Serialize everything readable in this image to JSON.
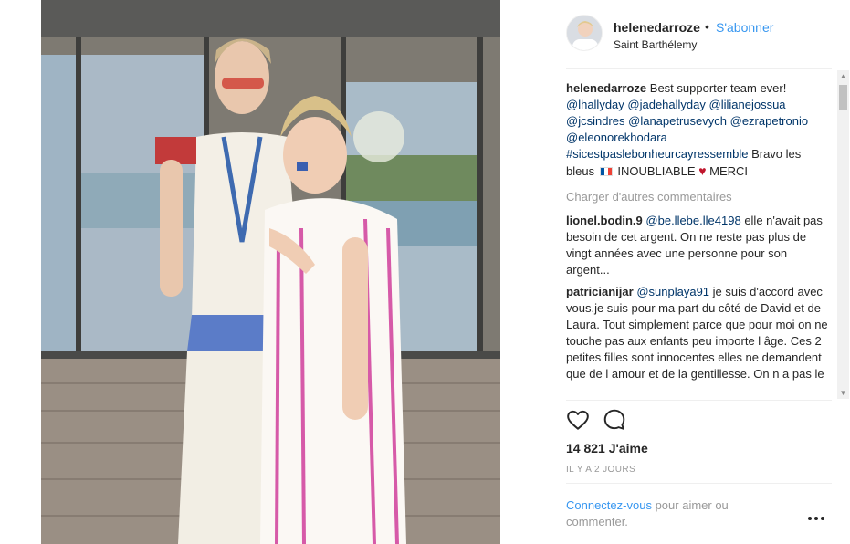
{
  "header": {
    "username": "helenedarroze",
    "dot": "•",
    "follow_label": "S'abonner",
    "location": "Saint Barthélemy"
  },
  "caption": {
    "username": "helenedarroze",
    "text_intro": "Best supporter team ever!",
    "mentions": [
      "@lhallyday",
      "@jadehallyday",
      "@lilianejossua",
      "@jcsindres",
      "@lanapetrusevych",
      "@ezrapetronio",
      "@eleonorekhodara",
      "#sicestpaslebonheurcayressemble"
    ],
    "text_bravo": "Bravo les bleus",
    "text_inoubliable": "INOUBLIABLE",
    "text_merci": "MERCI"
  },
  "load_more": "Charger d'autres commentaires",
  "comments": [
    {
      "username": "lionel.bodin.9",
      "mention": "@be.llebe.lle4198",
      "text": "elle n'avait pas besoin de cet argent. On ne reste pas plus de vingt années avec une personne pour son argent..."
    },
    {
      "username": "patricianijar",
      "mention": "@sunplaya91",
      "text": "je suis d'accord avec vous.je suis pour ma part du côté de David et de Laura. Tout simplement parce que pour moi on ne touche pas aux enfants peu importe l âge. Ces 2 petites filles sont innocentes elles ne demandent que de l amour et de la gentillesse. On n a pas le"
    }
  ],
  "likes": "14 821 J'aime",
  "time_ago": "IL Y A 2 JOURS",
  "footer": {
    "connect": "Connectez-vous",
    "rest": "pour aimer ou commenter."
  },
  "icons": {
    "like": "heart-outline-icon",
    "comment": "comment-bubble-icon",
    "more": "more-options-icon"
  },
  "colors": {
    "link_blue": "#3897f0",
    "mention_blue": "#003569",
    "muted": "#999999"
  }
}
